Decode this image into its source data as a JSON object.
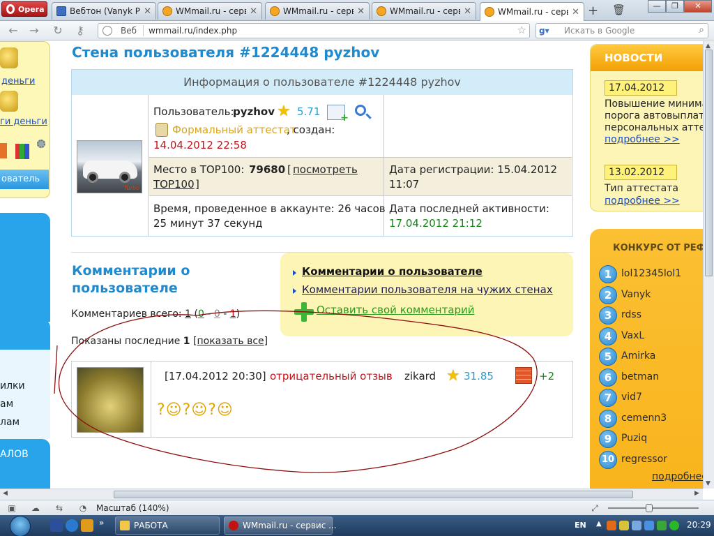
{
  "browser": {
    "menu_label": "Opera",
    "tabs": [
      {
        "title": "Вебтон (Vanyk Par..."
      },
      {
        "title": "WMmail.ru - серви..."
      },
      {
        "title": "WMmail.ru - серви..."
      },
      {
        "title": "WMmail.ru - серви..."
      },
      {
        "title": "WMmail.ru - серви..."
      }
    ],
    "address": {
      "zone_label": "Веб",
      "url": "wmmail.ru/index.php"
    },
    "search": {
      "placeholder": "Искать в Google"
    },
    "status": {
      "zoom_label": "Масштаб (140%)"
    }
  },
  "sidebar_left": {
    "link_1": "деньги",
    "link_2": "ги деньги",
    "user_button": "ователь",
    "item_1": "илки",
    "item_2": "ам",
    "item_3": "лам",
    "item_4": "АЛОВ"
  },
  "wall": {
    "title": "Стена пользователя #1224448 pyzhov",
    "info_header": "Информация о пользователе #1224448 pyzhov",
    "user_label": "Пользователь:",
    "username": "pyzhov",
    "rating": "5.71",
    "attestat": "Формальный аттестат",
    "created_label": ", создан:",
    "created_date": "14.04.2012 22:58",
    "top100_label": "Место в TOP100:",
    "top100_value": "79680",
    "top100_link_1": "посмотреть",
    "top100_link_2": "TOP100",
    "reg_label": "Дата регистрации: 15.04.2012",
    "reg_time": "11:07",
    "time_label": "Время, проведенное в аккаунте: 26 часов",
    "time_label_2": "25 минут 37 секунд",
    "activity_label": "Дата последней активности:",
    "activity_value": "17.04.2012 21:12"
  },
  "comments": {
    "title_line_1": "Комментарии о",
    "title_line_2": "пользователе",
    "total_label": "Комментариев всего:",
    "total": "1",
    "positive": "0",
    "neutral": "0",
    "negative": "1",
    "shown_label": "Показаны последние",
    "shown_count": "1",
    "show_all": "показать все",
    "links": {
      "about_user": "Комментарии о пользователе",
      "by_user": "Комментарии пользователя на чужих стенах",
      "leave": "Оставить свой комментарий"
    },
    "items": [
      {
        "datetime": "[17.04.2012 20:30]",
        "type": "отрицательный отзыв",
        "author": "zikard",
        "author_rating": "31.85",
        "score": "+2",
        "smileys": "?☺?☺?☺"
      }
    ]
  },
  "news": {
    "header": "НОВОСТИ",
    "items": [
      {
        "date": "17.04.2012",
        "lines": [
          "Повышение минима",
          "порога автовыплать",
          "персональных аттес"
        ],
        "more": "подробнее >>"
      },
      {
        "date": "13.02.2012",
        "lines": [
          "Тип аттестата"
        ],
        "more": "подробнее >>"
      }
    ]
  },
  "contest": {
    "header": "КОНКУРС ОТ РЕФ",
    "entries": [
      {
        "rank": "1",
        "name": "lol12345lol1"
      },
      {
        "rank": "2",
        "name": "Vanyk"
      },
      {
        "rank": "3",
        "name": "rdss"
      },
      {
        "rank": "4",
        "name": "VaxL"
      },
      {
        "rank": "5",
        "name": "Amirka"
      },
      {
        "rank": "6",
        "name": "betman"
      },
      {
        "rank": "7",
        "name": "vid7"
      },
      {
        "rank": "8",
        "name": "cemenn3"
      },
      {
        "rank": "9",
        "name": "Puziq"
      },
      {
        "rank": "10",
        "name": "regressor"
      }
    ],
    "more": "подробнее"
  },
  "taskbar": {
    "items": [
      {
        "label": "РАБОТА"
      },
      {
        "label": "WMmail.ru - сервис ..."
      }
    ],
    "language": "EN",
    "clock": "20:29"
  },
  "colors": {
    "title_blue": "#1e8ad0",
    "negative_red": "#c4121a",
    "activity_green": "#148a14",
    "news_orange": "#f29f05",
    "annotation_scribble": "#8b0e0e"
  }
}
